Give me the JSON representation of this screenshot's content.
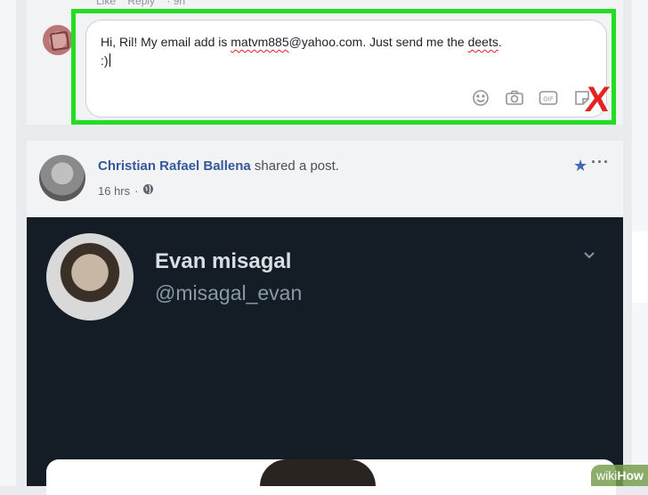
{
  "comment_actions": {
    "like": "Like",
    "reply": "Reply",
    "more": "· 9h"
  },
  "comment": {
    "text_1": "Hi, Ril! My email add is ",
    "misspelled_1": "matvm885",
    "text_2": "@yahoo.com. Just send me the ",
    "misspelled_2": "deets",
    "text_3": ".",
    "line2": ":)",
    "icons": [
      "emoji-icon",
      "camera-icon",
      "gif-icon",
      "sticker-icon"
    ]
  },
  "annotation": {
    "mark": "X",
    "color": "#e32420"
  },
  "post": {
    "author": "Christian Rafael Ballena",
    "action": "shared a post.",
    "time": "16 hrs",
    "privacy_icon": "globe-icon"
  },
  "tweet": {
    "name": "Evan misagal",
    "handle": "@misagal_evan"
  },
  "watermark": {
    "prefix": "wiki",
    "suffix": "How"
  },
  "colors": {
    "highlight": "#22dd22",
    "link": "#365899",
    "tweet_bg": "#141d26"
  }
}
